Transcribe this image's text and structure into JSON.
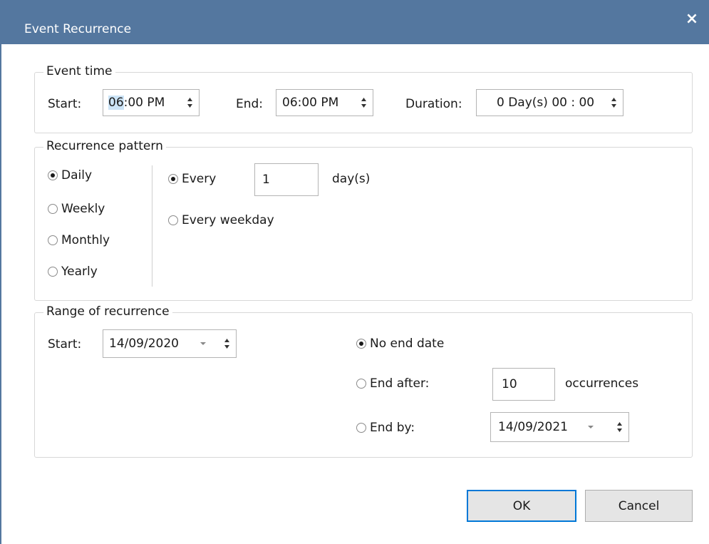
{
  "window": {
    "title": "Event Recurrence",
    "close_symbol": "×"
  },
  "event_time": {
    "legend": "Event time",
    "start_label": "Start:",
    "start_hour": "06",
    "start_rest": ":00 PM",
    "end_label": "End:",
    "end_value": "06:00 PM",
    "duration_label": "Duration:",
    "duration_value": "0 Day(s) 00 : 00"
  },
  "recurrence_pattern": {
    "legend": "Recurrence pattern",
    "types": [
      {
        "label": "Daily",
        "selected": true
      },
      {
        "label": "Weekly",
        "selected": false
      },
      {
        "label": "Monthly",
        "selected": false
      },
      {
        "label": "Yearly",
        "selected": false
      }
    ],
    "every_label": "Every",
    "every_value": "1",
    "every_unit": "day(s)",
    "every_weekday_label": "Every weekday"
  },
  "range": {
    "legend": "Range of recurrence",
    "start_label": "Start:",
    "start_value": "14/09/2020",
    "no_end_label": "No end date",
    "end_after_label": "End after:",
    "end_after_value": "10",
    "occurrences_label": "occurrences",
    "end_by_label": "End by:",
    "end_by_value": "14/09/2021"
  },
  "buttons": {
    "ok": "OK",
    "cancel": "Cancel"
  },
  "colors": {
    "titlebar": "#54779f",
    "accent": "#0078d7",
    "selection": "#cce4f7"
  }
}
